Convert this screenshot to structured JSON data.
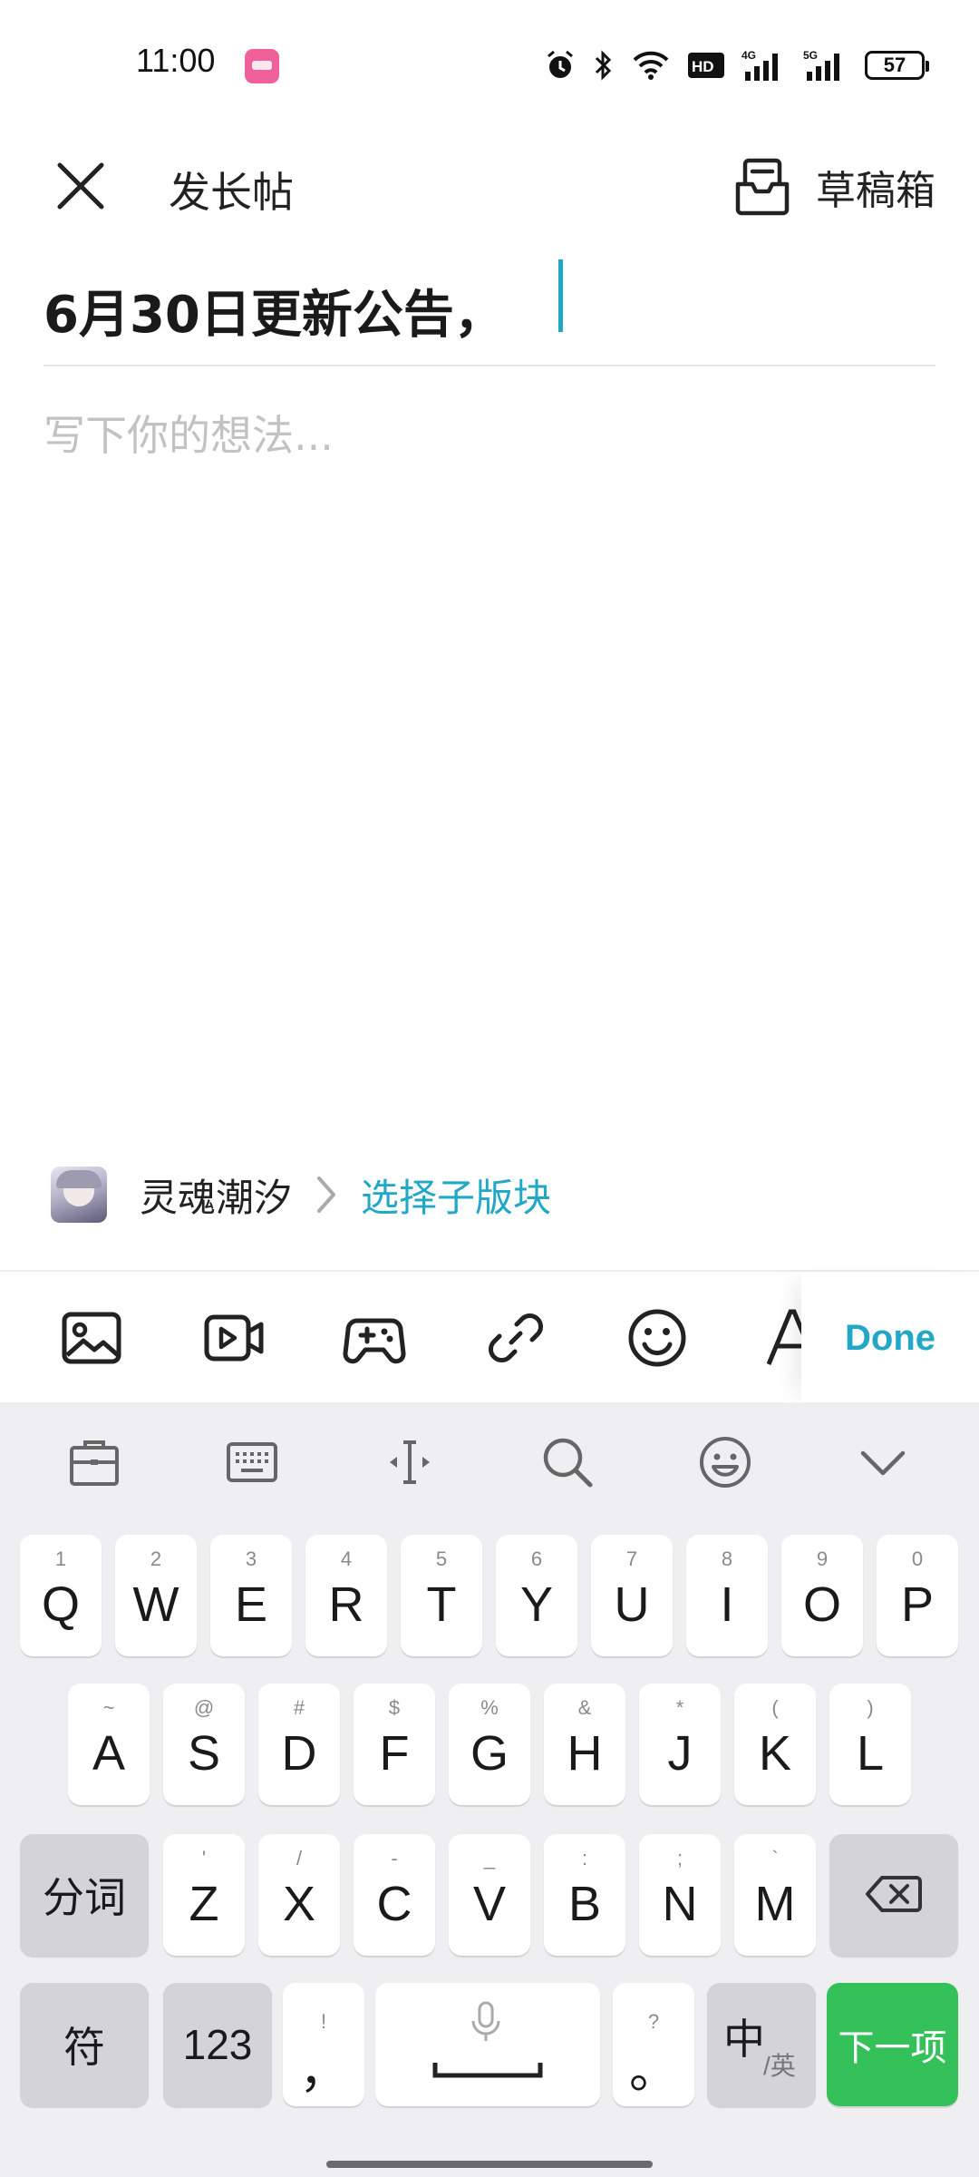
{
  "status_bar": {
    "time": "11:00",
    "battery": "57",
    "icons": [
      "alarm-icon",
      "bluetooth-icon",
      "wifi-icon",
      "hd-icon",
      "signal-4g-icon",
      "signal-5g-icon",
      "battery-icon"
    ]
  },
  "header": {
    "title": "发长帖",
    "drafts_label": "草稿箱"
  },
  "editor": {
    "title_value": "6月30日更新公告，",
    "body_placeholder": "写下你的想法..."
  },
  "forum": {
    "name": "灵魂潮汐",
    "subforum_link": "选择子版块"
  },
  "toolbar": {
    "tools": [
      "image-icon",
      "video-icon",
      "gamepad-icon",
      "link-icon",
      "emoji-icon",
      "text-format-icon"
    ],
    "done_label": "Done"
  },
  "keyboard": {
    "top_icons": [
      "clipboard-icon",
      "keyboard-icon",
      "cursor-icon",
      "search-icon",
      "emoji-icon",
      "collapse-icon"
    ],
    "row1": [
      {
        "hint": "1",
        "key": "Q"
      },
      {
        "hint": "2",
        "key": "W"
      },
      {
        "hint": "3",
        "key": "E"
      },
      {
        "hint": "4",
        "key": "R"
      },
      {
        "hint": "5",
        "key": "T"
      },
      {
        "hint": "6",
        "key": "Y"
      },
      {
        "hint": "7",
        "key": "U"
      },
      {
        "hint": "8",
        "key": "I"
      },
      {
        "hint": "9",
        "key": "O"
      },
      {
        "hint": "0",
        "key": "P"
      }
    ],
    "row2": [
      {
        "hint": "~",
        "key": "A"
      },
      {
        "hint": "@",
        "key": "S"
      },
      {
        "hint": "#",
        "key": "D"
      },
      {
        "hint": "$",
        "key": "F"
      },
      {
        "hint": "%",
        "key": "G"
      },
      {
        "hint": "&",
        "key": "H"
      },
      {
        "hint": "*",
        "key": "J"
      },
      {
        "hint": "(",
        "key": "K"
      },
      {
        "hint": ")",
        "key": "L"
      }
    ],
    "row3": {
      "left": "分词",
      "keys": [
        {
          "hint": "'",
          "key": "Z"
        },
        {
          "hint": "/",
          "key": "X"
        },
        {
          "hint": "-",
          "key": "C"
        },
        {
          "hint": "_",
          "key": "V"
        },
        {
          "hint": ":",
          "key": "B"
        },
        {
          "hint": ";",
          "key": "N"
        },
        {
          "hint": "`",
          "key": "M"
        }
      ]
    },
    "row4": {
      "symbols": "符",
      "numbers": "123",
      "comma_hint": "!",
      "comma": "，",
      "period_hint": "?",
      "period": "。",
      "lang_main": "中",
      "lang_sub": "/英",
      "next": "下一项"
    }
  }
}
